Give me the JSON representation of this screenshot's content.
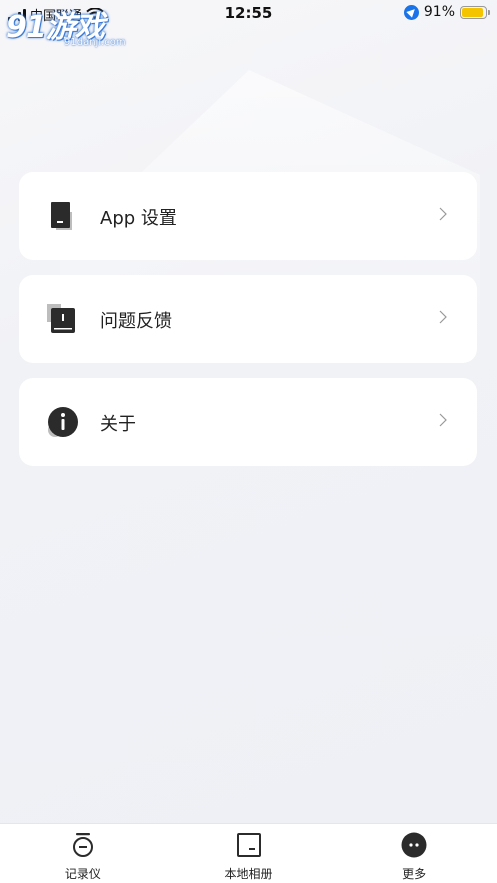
{
  "status_bar": {
    "carrier": "中国联通",
    "time": "12:55",
    "battery": "91%",
    "battery_level": 0.91
  },
  "watermark": {
    "main": "91游戏",
    "sub": "91danji.com"
  },
  "menu": {
    "items": [
      {
        "label": "App 设置",
        "icon": "app-settings-icon"
      },
      {
        "label": "问题反馈",
        "icon": "feedback-icon"
      },
      {
        "label": "关于",
        "icon": "info-icon"
      }
    ]
  },
  "tabs": [
    {
      "label": "记录仪",
      "icon": "recorder-icon"
    },
    {
      "label": "本地相册",
      "icon": "album-icon"
    },
    {
      "label": "更多",
      "icon": "more-icon"
    }
  ],
  "colors": {
    "accent": "#2b2b2b",
    "battery": "#f5c400",
    "location": "#1a73e8"
  }
}
